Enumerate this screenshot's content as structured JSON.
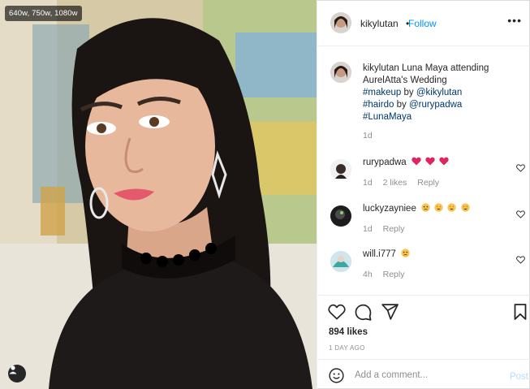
{
  "photo": {
    "size_badge": "640w, 750w, 1080w"
  },
  "header": {
    "username": "kikylutan",
    "dot": "•",
    "follow_label": "Follow",
    "more_label": "•••"
  },
  "caption": {
    "username": "kikylutan",
    "text_part1": "Luna Maya attending AurelAtta's Wedding",
    "tag_makeup": "#makeup",
    "by1": "by",
    "mention_kiky": "@kikylutan",
    "tag_hairdo": "#hairdo",
    "by2": "by",
    "mention_rury": "@rurypadwa",
    "tag_lunamaya": "#LunaMaya",
    "age": "1d"
  },
  "comments": [
    {
      "username": "rurypadwa",
      "age": "1d",
      "likes": "2 likes",
      "reply": "Reply",
      "emojis": [
        "red-heart",
        "red-heart",
        "red-heart"
      ]
    },
    {
      "username": "luckyzayniee",
      "age": "1d",
      "reply": "Reply",
      "emojis": [
        "worried-face",
        "star-struck",
        "star-struck",
        "star-struck"
      ]
    },
    {
      "username": "will.i777",
      "age": "4h",
      "reply": "Reply",
      "emojis": [
        "worried-face"
      ]
    }
  ],
  "actions": {
    "likes": "894 likes",
    "date": "1 DAY AGO"
  },
  "add_comment": {
    "placeholder": "Add a comment...",
    "post_label": "Post"
  },
  "colors": {
    "link_blue": "#0095f6",
    "hashtag_blue": "#00376b",
    "muted_text": "#8e8e8e",
    "post_disabled": "#b2dffc"
  }
}
